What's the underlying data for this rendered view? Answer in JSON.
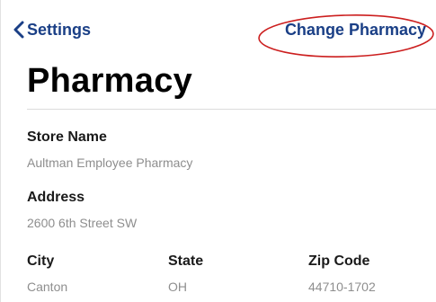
{
  "nav": {
    "back_label": "Settings",
    "action_label": "Change Pharmacy",
    "accent_color": "#1a3f86",
    "annotation_color": "#cc1f1f"
  },
  "page": {
    "title": "Pharmacy"
  },
  "fields": {
    "store_name": {
      "label": "Store Name",
      "value": "Aultman Employee Pharmacy"
    },
    "address": {
      "label": "Address",
      "value": "2600 6th Street SW"
    },
    "city": {
      "label": "City",
      "value": "Canton"
    },
    "state": {
      "label": "State",
      "value": "OH"
    },
    "zip": {
      "label": "Zip Code",
      "value": "44710-1702"
    }
  }
}
